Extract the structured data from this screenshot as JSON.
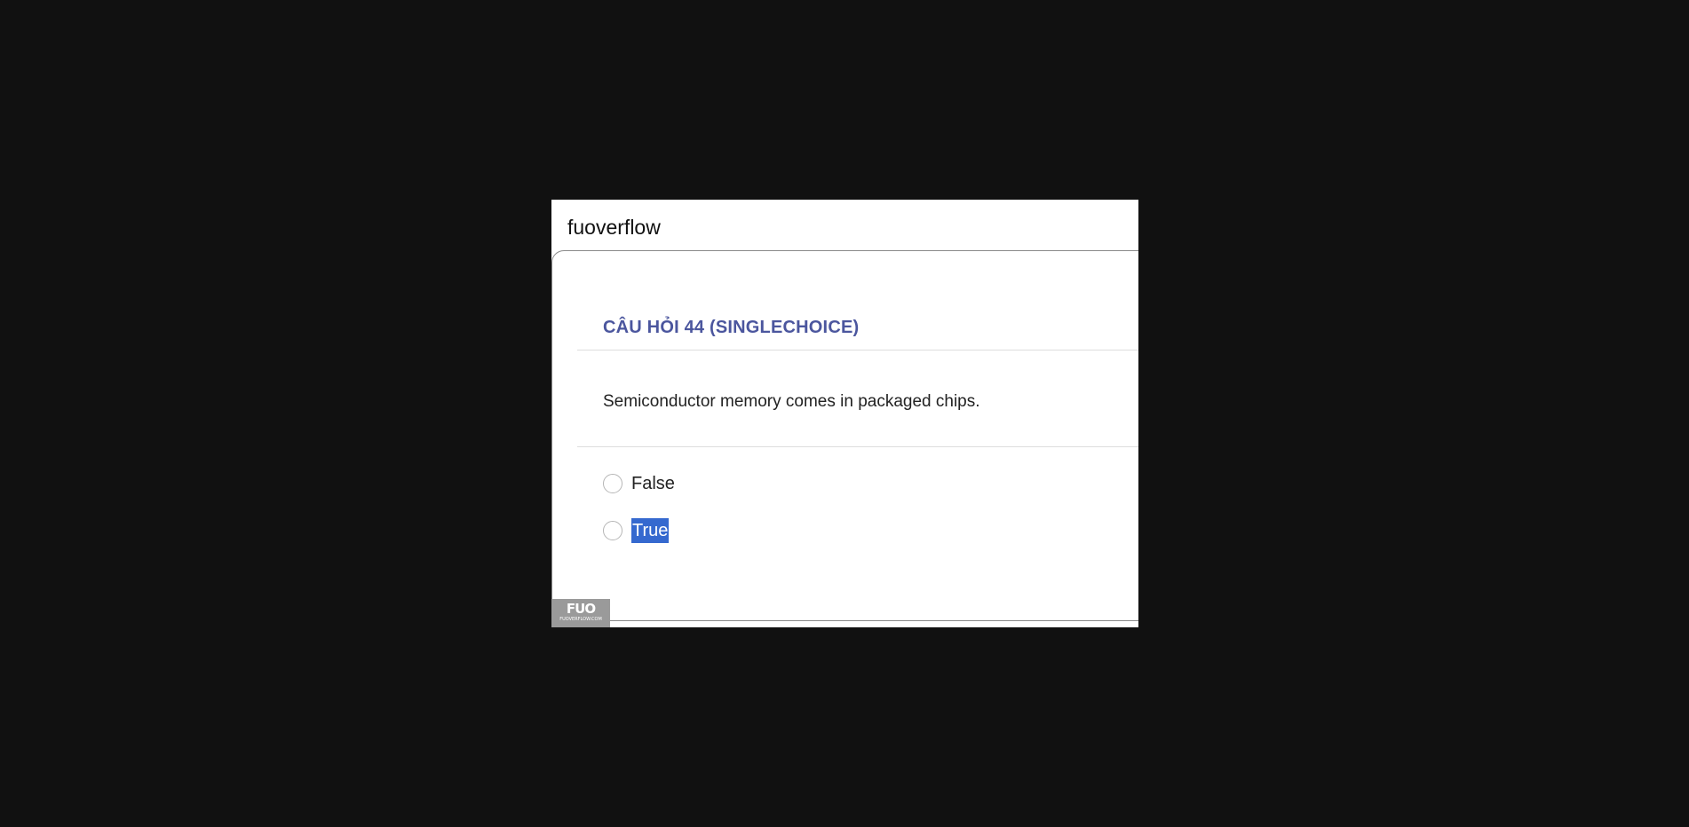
{
  "site": {
    "title": "fuoverflow"
  },
  "question": {
    "title": "CÂU HỎI 44 (SINGLECHOICE)",
    "text": "Semiconductor memory comes in packaged chips.",
    "options": [
      {
        "label": "False",
        "selected_text": false
      },
      {
        "label": "True",
        "selected_text": true
      }
    ]
  },
  "watermark": {
    "logo": "FUO",
    "domain": "FUOVERFLOW.COM"
  },
  "colors": {
    "background": "#111111",
    "question_title": "#4b569e",
    "selection_highlight": "#3569cf"
  }
}
